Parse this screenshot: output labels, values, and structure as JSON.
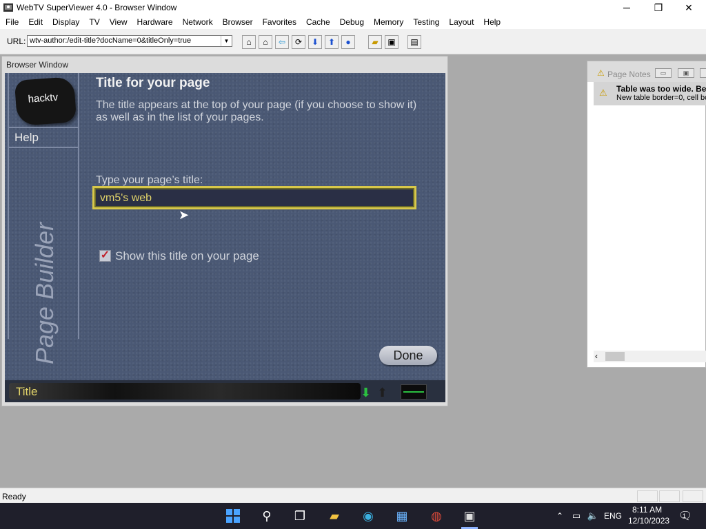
{
  "app": {
    "title": "WebTV SuperViewer 4.0 - Browser Window",
    "icon": "webtv-icon"
  },
  "window_controls": {
    "minimize": "─",
    "restore": "❐",
    "close": "✕"
  },
  "menu": [
    "File",
    "Edit",
    "Display",
    "TV",
    "View",
    "Hardware",
    "Network",
    "Browser",
    "Favorites",
    "Cache",
    "Debug",
    "Memory",
    "Testing",
    "Layout",
    "Help"
  ],
  "toolbar": {
    "url_label": "URL:",
    "url_value": "wtv-author:/edit-title?docName=0&titleOnly=true",
    "buttons": [
      "home-alt-icon",
      "home-icon",
      "back-arrow-icon",
      "reload-icon",
      "down-arrow-icon",
      "up-arrow-icon",
      "stop-icon",
      "open-folder-icon",
      "save-icon",
      "document-icon"
    ]
  },
  "browser_window": {
    "title": "Browser Window",
    "logo_text": "hacktv",
    "help_label": "Help",
    "side_caption": "Page Builder",
    "heading": "Title for your page",
    "description": "The title appears at the top of your page (if you choose to show it) as well as in the list of your pages.",
    "field_label": "Type your page’s title:",
    "field_value": "vm5's web",
    "checkbox_checked": true,
    "checkbox_label": "Show this title on your page",
    "done_label": "Done",
    "status_label": "Title"
  },
  "page_notes": {
    "title": "Page Notes",
    "note_title": "Table was too wide. Be",
    "note_detail": "New table border=0, cell bo"
  },
  "statusbar": {
    "text": "Ready"
  },
  "taskbar": {
    "tray_lang": "ENG",
    "time": "8:11 AM",
    "date": "12/10/2023",
    "notification_count": "1"
  },
  "colors": {
    "webtv_bg": "#4a5874",
    "accent_yellow": "#d8c84a",
    "done_green": "#2bc040"
  }
}
